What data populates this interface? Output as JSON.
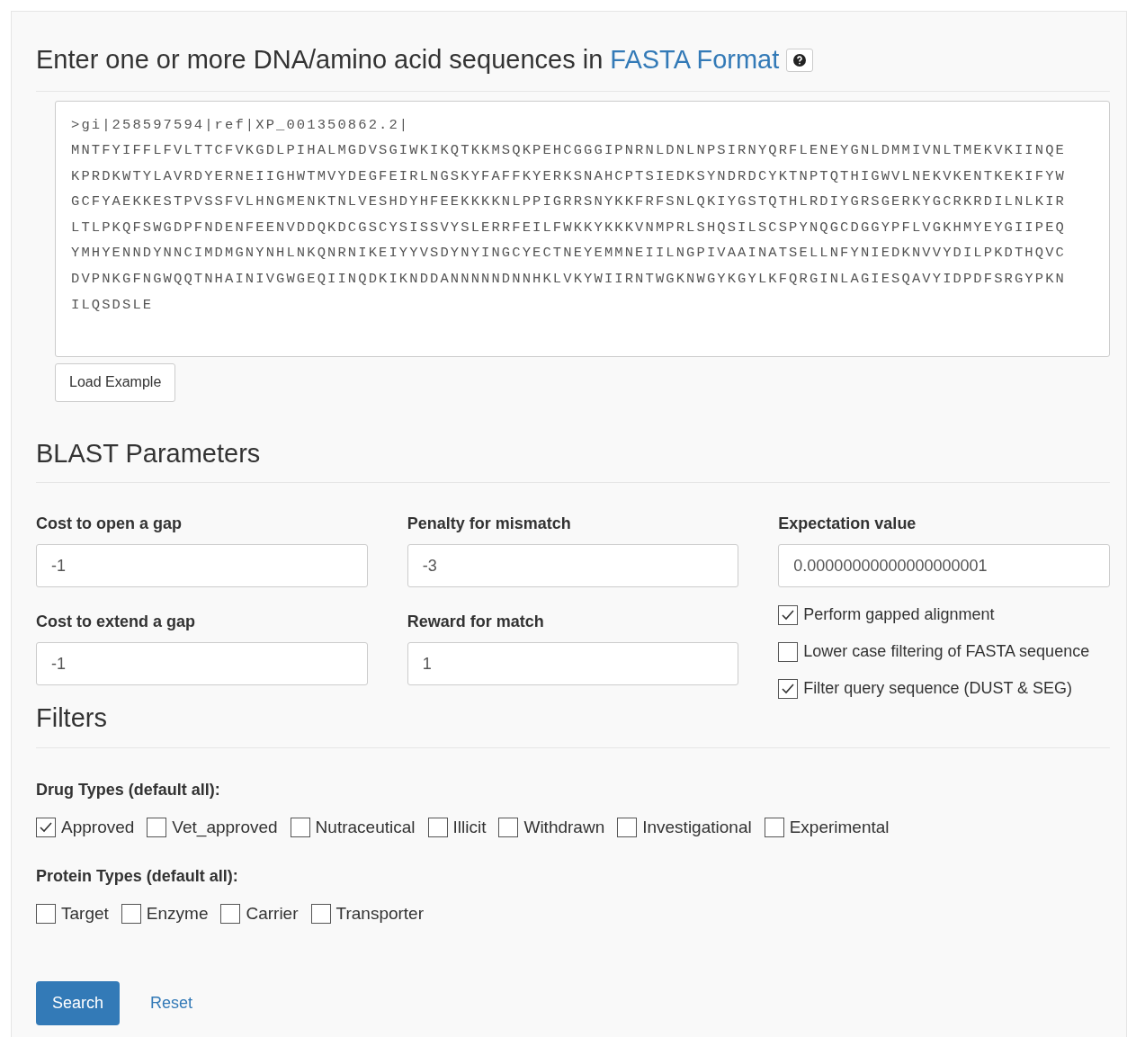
{
  "heading": {
    "text": "Enter one or more DNA/amino acid sequences in",
    "link": "FASTA Format"
  },
  "sequence": {
    "lines": [
      ">gi|258597594|ref|XP_001350862.2|",
      "MNTFYIFFLFVLTTCFVKGDLPIHALMGDVSGIWKIKQTKKMSQKPEHCGGGIPNRNLDNLNPSIRNYQRFLENEYGNLDMMIVNLTMEKVKIINQE",
      "KPRDKWTYLAVRDYERNEIIGHWTMVYDEGFEIRLNGSKYFAFFKYERKSNAHCPTSIEDKSYNDRDCYKTNPTQTHIGWVLNEKVKENTKEKIFYW",
      "GCFYAEKKESTPVSSFVLHNGMENKTNLVESHDYHFEEKKKKNLPPIGRRSNYKKFRFSNLQKIYGSTQTHLRDIYGRSGERKYGCRKRDILNLKIR",
      "LTLPKQFSWGDPFNDENFEENVDDQKDCGSCYSISSVYSLERRFEILFWKKYKKKVNMPRLSHQSILSCSPYNQGCDGGYPFLVGKHMYEYGIIPEQ",
      "YMHYENNDYNNCIMDMGNYNHLNKQNRNIKEIYYVSDYNYINGCYECTNEYEMMNEIILNGPIVAAINATSELLNFYNIEDKNVVYDILPKDTHQVC",
      "DVPNKGFNGWQQTNHAINIVGWGEQIINQDKIKNDDANNNNNDNNHKLVKYWIIRNTWGKNWGYKGYLKFQRGINLAGIESQAVYIDPDFSRGYPKN",
      "ILQSDSLE"
    ]
  },
  "load_example": "Load Example",
  "blast": {
    "title": "BLAST Parameters",
    "fields": [
      {
        "label": "Cost to open a gap",
        "value": "-1"
      },
      {
        "label": "Penalty for mismatch",
        "value": "-3"
      },
      {
        "label": "Expectation value",
        "value": "0.00000000000000000001"
      },
      {
        "label": "Cost to extend a gap",
        "value": "-1"
      },
      {
        "label": "Reward for match",
        "value": "1"
      }
    ],
    "options": [
      {
        "label": "Perform gapped alignment",
        "checked": true
      },
      {
        "label": "Lower case filtering of FASTA sequence",
        "checked": false
      },
      {
        "label": "Filter query sequence (DUST & SEG)",
        "checked": true
      }
    ]
  },
  "filters": {
    "title": "Filters",
    "groups": [
      {
        "label": "Drug Types (default all):",
        "items": [
          {
            "label": "Approved",
            "checked": true
          },
          {
            "label": "Vet_approved",
            "checked": false
          },
          {
            "label": "Nutraceutical",
            "checked": false
          },
          {
            "label": "Illicit",
            "checked": false
          },
          {
            "label": "Withdrawn",
            "checked": false
          },
          {
            "label": "Investigational",
            "checked": false
          },
          {
            "label": "Experimental",
            "checked": false
          }
        ]
      },
      {
        "label": "Protein Types (default all):",
        "items": [
          {
            "label": "Target",
            "checked": false
          },
          {
            "label": "Enzyme",
            "checked": false
          },
          {
            "label": "Carrier",
            "checked": false
          },
          {
            "label": "Transporter",
            "checked": false
          }
        ]
      }
    ]
  },
  "actions": {
    "search": "Search",
    "reset": "Reset"
  }
}
